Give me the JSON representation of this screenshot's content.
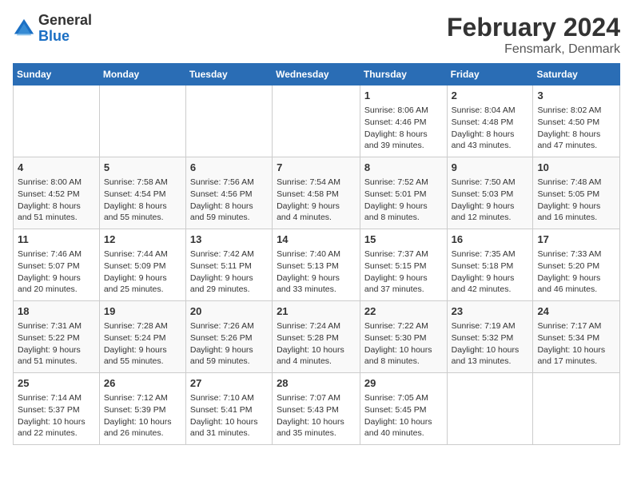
{
  "header": {
    "logo_general": "General",
    "logo_blue": "Blue",
    "title": "February 2024",
    "subtitle": "Fensmark, Denmark"
  },
  "weekdays": [
    "Sunday",
    "Monday",
    "Tuesday",
    "Wednesday",
    "Thursday",
    "Friday",
    "Saturday"
  ],
  "weeks": [
    [
      {
        "day": "",
        "content": ""
      },
      {
        "day": "",
        "content": ""
      },
      {
        "day": "",
        "content": ""
      },
      {
        "day": "",
        "content": ""
      },
      {
        "day": "1",
        "content": "Sunrise: 8:06 AM\nSunset: 4:46 PM\nDaylight: 8 hours\nand 39 minutes."
      },
      {
        "day": "2",
        "content": "Sunrise: 8:04 AM\nSunset: 4:48 PM\nDaylight: 8 hours\nand 43 minutes."
      },
      {
        "day": "3",
        "content": "Sunrise: 8:02 AM\nSunset: 4:50 PM\nDaylight: 8 hours\nand 47 minutes."
      }
    ],
    [
      {
        "day": "4",
        "content": "Sunrise: 8:00 AM\nSunset: 4:52 PM\nDaylight: 8 hours\nand 51 minutes."
      },
      {
        "day": "5",
        "content": "Sunrise: 7:58 AM\nSunset: 4:54 PM\nDaylight: 8 hours\nand 55 minutes."
      },
      {
        "day": "6",
        "content": "Sunrise: 7:56 AM\nSunset: 4:56 PM\nDaylight: 8 hours\nand 59 minutes."
      },
      {
        "day": "7",
        "content": "Sunrise: 7:54 AM\nSunset: 4:58 PM\nDaylight: 9 hours\nand 4 minutes."
      },
      {
        "day": "8",
        "content": "Sunrise: 7:52 AM\nSunset: 5:01 PM\nDaylight: 9 hours\nand 8 minutes."
      },
      {
        "day": "9",
        "content": "Sunrise: 7:50 AM\nSunset: 5:03 PM\nDaylight: 9 hours\nand 12 minutes."
      },
      {
        "day": "10",
        "content": "Sunrise: 7:48 AM\nSunset: 5:05 PM\nDaylight: 9 hours\nand 16 minutes."
      }
    ],
    [
      {
        "day": "11",
        "content": "Sunrise: 7:46 AM\nSunset: 5:07 PM\nDaylight: 9 hours\nand 20 minutes."
      },
      {
        "day": "12",
        "content": "Sunrise: 7:44 AM\nSunset: 5:09 PM\nDaylight: 9 hours\nand 25 minutes."
      },
      {
        "day": "13",
        "content": "Sunrise: 7:42 AM\nSunset: 5:11 PM\nDaylight: 9 hours\nand 29 minutes."
      },
      {
        "day": "14",
        "content": "Sunrise: 7:40 AM\nSunset: 5:13 PM\nDaylight: 9 hours\nand 33 minutes."
      },
      {
        "day": "15",
        "content": "Sunrise: 7:37 AM\nSunset: 5:15 PM\nDaylight: 9 hours\nand 37 minutes."
      },
      {
        "day": "16",
        "content": "Sunrise: 7:35 AM\nSunset: 5:18 PM\nDaylight: 9 hours\nand 42 minutes."
      },
      {
        "day": "17",
        "content": "Sunrise: 7:33 AM\nSunset: 5:20 PM\nDaylight: 9 hours\nand 46 minutes."
      }
    ],
    [
      {
        "day": "18",
        "content": "Sunrise: 7:31 AM\nSunset: 5:22 PM\nDaylight: 9 hours\nand 51 minutes."
      },
      {
        "day": "19",
        "content": "Sunrise: 7:28 AM\nSunset: 5:24 PM\nDaylight: 9 hours\nand 55 minutes."
      },
      {
        "day": "20",
        "content": "Sunrise: 7:26 AM\nSunset: 5:26 PM\nDaylight: 9 hours\nand 59 minutes."
      },
      {
        "day": "21",
        "content": "Sunrise: 7:24 AM\nSunset: 5:28 PM\nDaylight: 10 hours\nand 4 minutes."
      },
      {
        "day": "22",
        "content": "Sunrise: 7:22 AM\nSunset: 5:30 PM\nDaylight: 10 hours\nand 8 minutes."
      },
      {
        "day": "23",
        "content": "Sunrise: 7:19 AM\nSunset: 5:32 PM\nDaylight: 10 hours\nand 13 minutes."
      },
      {
        "day": "24",
        "content": "Sunrise: 7:17 AM\nSunset: 5:34 PM\nDaylight: 10 hours\nand 17 minutes."
      }
    ],
    [
      {
        "day": "25",
        "content": "Sunrise: 7:14 AM\nSunset: 5:37 PM\nDaylight: 10 hours\nand 22 minutes."
      },
      {
        "day": "26",
        "content": "Sunrise: 7:12 AM\nSunset: 5:39 PM\nDaylight: 10 hours\nand 26 minutes."
      },
      {
        "day": "27",
        "content": "Sunrise: 7:10 AM\nSunset: 5:41 PM\nDaylight: 10 hours\nand 31 minutes."
      },
      {
        "day": "28",
        "content": "Sunrise: 7:07 AM\nSunset: 5:43 PM\nDaylight: 10 hours\nand 35 minutes."
      },
      {
        "day": "29",
        "content": "Sunrise: 7:05 AM\nSunset: 5:45 PM\nDaylight: 10 hours\nand 40 minutes."
      },
      {
        "day": "",
        "content": ""
      },
      {
        "day": "",
        "content": ""
      }
    ]
  ]
}
